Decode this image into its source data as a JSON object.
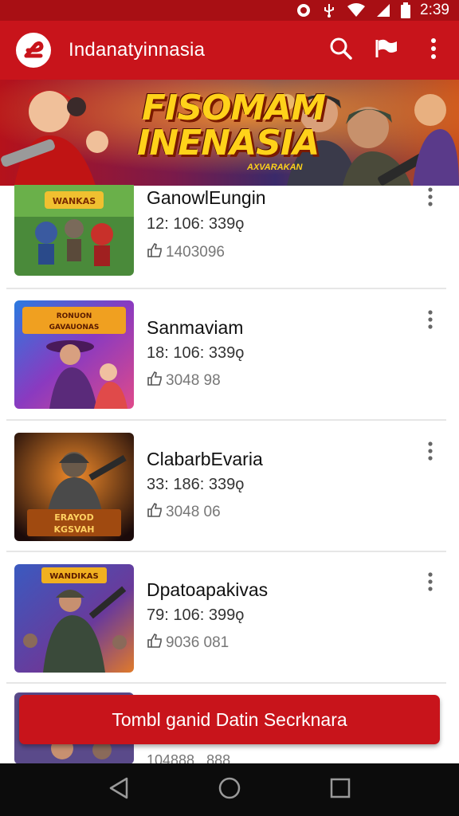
{
  "status_bar": {
    "time": "2:39",
    "icons": [
      "notification-icon",
      "usb-icon",
      "wifi-icon",
      "signal-icon",
      "battery-icon"
    ]
  },
  "app_bar": {
    "title": "Indanatyinnasia",
    "actions": [
      "search-icon",
      "flag-icon",
      "more-vert-icon"
    ]
  },
  "banner": {
    "title_line1": "FISOMAM",
    "title_line2": "INENASIA",
    "subtitle": "AXVARAKAN"
  },
  "items": [
    {
      "title": "GanowlEungin",
      "meta": "12: 106: 339ǫ",
      "likes": "1403096"
    },
    {
      "title": "Sanmaviam",
      "meta": "18: 106: 339ǫ",
      "likes": "3048 98"
    },
    {
      "title": "ClabarbEvaria",
      "meta": "33: 186: 339ǫ",
      "likes": "3048 06"
    },
    {
      "title": "Dpatoapakivas",
      "meta": "79: 106: 399ǫ",
      "likes": "9036 081"
    }
  ],
  "thumb_labels": [
    "WANKAS",
    "RONUON GAVAUONAS",
    "ERAYOD KGSVAH",
    "WANDIKAS"
  ],
  "peek_meta": "104888 , 888",
  "cta": {
    "label": "Tombl ganid Datin Secrknara"
  },
  "colors": {
    "primary": "#c8141b",
    "primary_dark": "#a80f14",
    "nav": "#0c0c0c"
  },
  "nav": [
    "back-icon",
    "home-icon",
    "recents-icon"
  ]
}
